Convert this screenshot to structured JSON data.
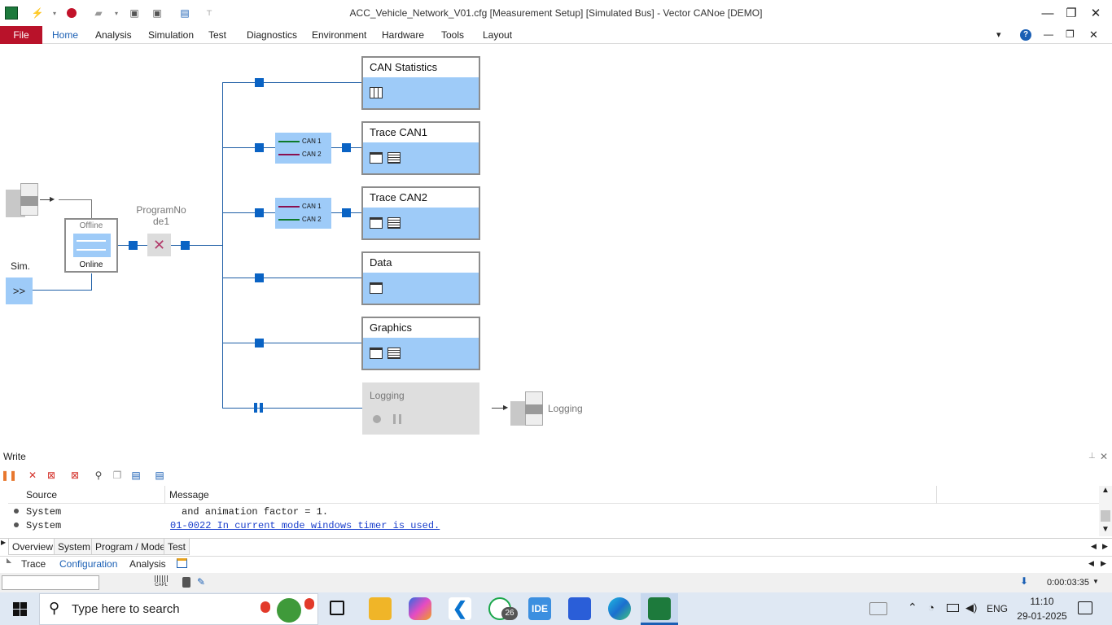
{
  "window": {
    "title": "ACC_Vehicle_Network_V01.cfg [Measurement Setup] [Simulated Bus] - Vector CANoe [DEMO]"
  },
  "ribbon": {
    "file": "File",
    "tabs": [
      "Home",
      "Analysis",
      "Simulation",
      "Test",
      "Diagnostics",
      "Environment",
      "Hardware",
      "Tools",
      "Layout"
    ],
    "active_tab": "Home"
  },
  "setup": {
    "sim_label": "Sim.",
    "sim_button": ">>",
    "offline": "Offline",
    "online": "Online",
    "program_node": "ProgramNo\nde1",
    "blocks": [
      "CAN Statistics",
      "Trace CAN1",
      "Trace CAN2",
      "Data",
      "Graphics"
    ],
    "logging_block": "Logging",
    "logging_file": "Logging",
    "can1": "CAN 1",
    "can2": "CAN 2"
  },
  "write": {
    "title": "Write",
    "col_source": "Source",
    "col_message": "Message",
    "rows": [
      {
        "source": "System",
        "message": "and animation factor = 1.",
        "link": false
      },
      {
        "source": "System",
        "message": "01-0022 In current mode windows timer is used.",
        "link": true
      }
    ],
    "tabs": [
      "Overview",
      "System",
      "Program / Model",
      "Test"
    ]
  },
  "bottom_tabs": [
    "Trace",
    "Configuration",
    "Analysis"
  ],
  "bottom_active": "Configuration",
  "status": {
    "time": "0:00:03:35",
    "capl": "CAPL"
  },
  "taskbar": {
    "search_placeholder": "Type here to search",
    "whatsapp_badge": "26",
    "ide_label": "IDE",
    "language": "ENG",
    "clock_time": "11:10",
    "clock_date": "29-01-2025"
  },
  "colors": {
    "accent": "#1a5fb4",
    "file_tab": "#b9122a",
    "block_fill": "#9ecbf8",
    "node": "#0a63c4",
    "link": "#1a3fcc"
  }
}
